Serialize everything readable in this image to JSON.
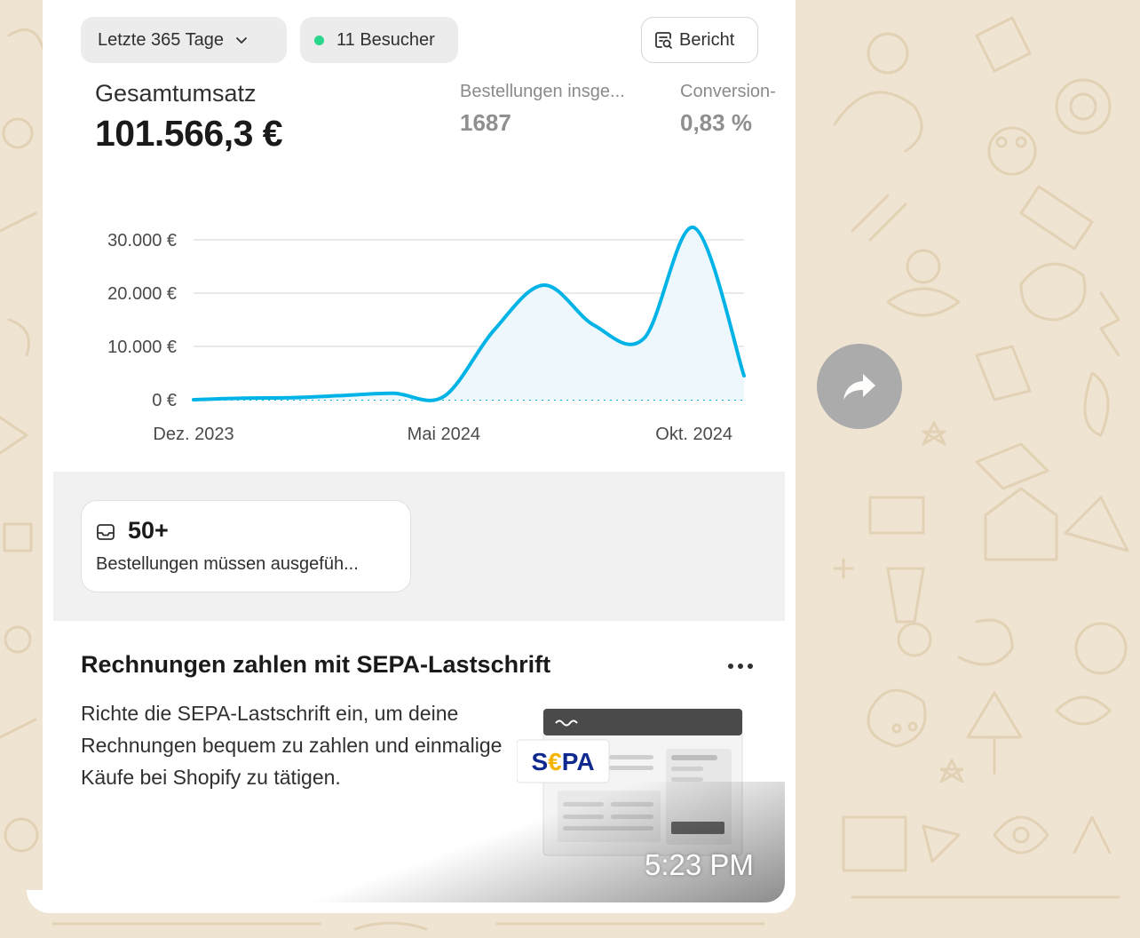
{
  "colors": {
    "wallpaper": "#efe4d2",
    "accent_line": "#00b3e6",
    "visitor_dot": "#29d68a",
    "forward_button": "#a9a9a9"
  },
  "header": {
    "period_label": "Letzte 365 Tage",
    "visitors_label": "11 Besucher",
    "report_label": "Bericht"
  },
  "metrics": {
    "total_sales_label": "Gesamtumsatz",
    "total_sales_value": "101.566,3 €",
    "orders_label": "Bestellungen insge...",
    "orders_value": "1687",
    "conversion_label": "Conversion-",
    "conversion_value": "0,83 %"
  },
  "chart_data": {
    "type": "line",
    "y_tick_labels": [
      "30.000 €",
      "20.000 €",
      "10.000 €",
      "0 €"
    ],
    "x_tick_labels": [
      "Dez. 2023",
      "Mai 2024",
      "Okt. 2024"
    ],
    "ylim": [
      0,
      30000
    ],
    "series": [
      {
        "values": [
          {
            "x": "2023-12",
            "y": 0
          },
          {
            "x": "2024-01",
            "y": 300
          },
          {
            "x": "2024-02",
            "y": 400
          },
          {
            "x": "2024-03",
            "y": 800
          },
          {
            "x": "2024-04",
            "y": 1200
          },
          {
            "x": "2024-05",
            "y": 600
          },
          {
            "x": "2024-06",
            "y": 13000
          },
          {
            "x": "2024-07",
            "y": 21500
          },
          {
            "x": "2024-08",
            "y": 14000
          },
          {
            "x": "2024-09",
            "y": 11500
          },
          {
            "x": "2024-10",
            "y": 32300
          },
          {
            "x": "2024-11",
            "y": 4500
          }
        ]
      },
      {
        "style": "dotted",
        "values": [
          {
            "x": "2023-12",
            "y": 0
          },
          {
            "x": "2024-11",
            "y": 0
          }
        ]
      }
    ],
    "grid": true
  },
  "orders_card": {
    "count": "50+",
    "text": "Bestellungen müssen ausgefüh..."
  },
  "sepa_card": {
    "title": "Rechnungen zahlen mit SEPA-Lastschrift",
    "body": "Richte die SEPA-Lastschrift ein, um deine Rechnungen bequem zu zahlen und einmalige Käufe bei Shopify zu tätigen.",
    "logo_text": "S€PA"
  },
  "message": {
    "timestamp": "5:23 PM"
  }
}
